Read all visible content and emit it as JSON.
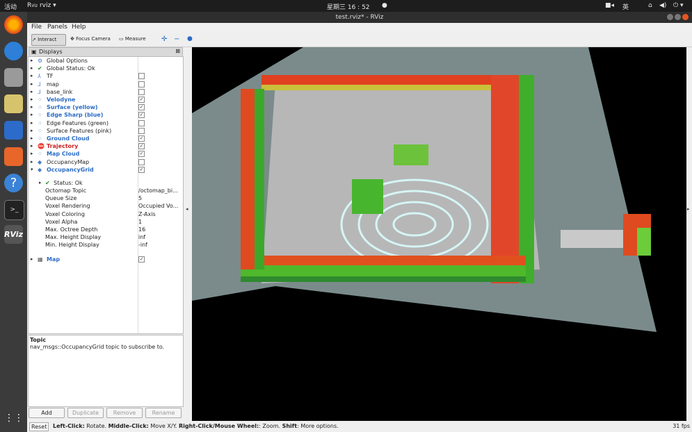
{
  "system_bar": {
    "activities": "活动",
    "app": "rviz",
    "clock": "星期三 16 : 52",
    "lang": "英"
  },
  "window": {
    "title": "test.rviz* - RViz"
  },
  "menu": [
    "File",
    "Panels",
    "Help"
  ],
  "toolbar": {
    "interact": "Interact",
    "focus_camera": "Focus Camera",
    "measure": "Measure"
  },
  "displays": {
    "title": "Displays",
    "rows": [
      {
        "label": "Global Options",
        "icon": "gear-icon",
        "style": "normal"
      },
      {
        "label": "Global Status: Ok",
        "icon": "check-icon",
        "style": "normal"
      },
      {
        "label": "TF",
        "icon": "tf-icon",
        "style": "normal",
        "checked": false
      },
      {
        "label": "map",
        "icon": "axes-icon",
        "style": "normal",
        "checked": false
      },
      {
        "label": "base_link",
        "icon": "axes-icon",
        "style": "normal",
        "checked": false
      },
      {
        "label": "Velodyne",
        "icon": "pointcloud-icon",
        "style": "blue",
        "checked": true
      },
      {
        "label": "Surface (yellow)",
        "icon": "pointcloud-icon",
        "style": "blue",
        "checked": true
      },
      {
        "label": "Edge Sharp (blue)",
        "icon": "pointcloud-icon",
        "style": "blue",
        "checked": true
      },
      {
        "label": "Edge Features (green)",
        "icon": "pointcloud-icon",
        "style": "normal",
        "checked": false
      },
      {
        "label": "Surface Features (pink)",
        "icon": "pointcloud-icon",
        "style": "normal",
        "checked": false
      },
      {
        "label": "Ground Cloud",
        "icon": "pointcloud-icon",
        "style": "blue",
        "checked": true
      },
      {
        "label": "Trajectory",
        "icon": "error-icon",
        "style": "red",
        "checked": true
      },
      {
        "label": "Map Cloud",
        "icon": "pointcloud-icon",
        "style": "blue",
        "checked": true
      },
      {
        "label": "OccupancyMap",
        "icon": "occupancy-icon",
        "style": "normal",
        "checked": false
      },
      {
        "label": "OccupancyGrid",
        "icon": "occupancy-icon",
        "style": "blue",
        "checked": true
      }
    ],
    "status_ok": "Status: Ok",
    "properties": [
      {
        "name": "Octomap Topic",
        "value": "/octomap_bi..."
      },
      {
        "name": "Queue Size",
        "value": "5"
      },
      {
        "name": "Voxel Rendering",
        "value": "Occupied Vo..."
      },
      {
        "name": "Voxel Coloring",
        "value": "Z-Axis"
      },
      {
        "name": "Voxel Alpha",
        "value": "1"
      },
      {
        "name": "Max. Octree Depth",
        "value": "16"
      },
      {
        "name": "Max. Height Display",
        "value": "inf"
      },
      {
        "name": "Min. Height Display",
        "value": "-inf"
      }
    ],
    "map_row": {
      "label": "Map",
      "checked": true
    }
  },
  "description": {
    "title": "Topic",
    "text": "nav_msgs::OccupancyGrid topic to subscribe to."
  },
  "buttons": {
    "add": "Add",
    "duplicate": "Duplicate",
    "remove": "Remove",
    "rename": "Rename"
  },
  "status": {
    "reset": "Reset",
    "left_click": "Left-Click:",
    "left_desc": " Rotate. ",
    "middle_click": "Middle-Click:",
    "middle_desc": " Move X/Y. ",
    "right_click": "Right-Click/Mouse Wheel:",
    "right_desc": ": Zoom. ",
    "shift": "Shift",
    "shift_desc": ": More options.",
    "fps": "31 fps"
  }
}
